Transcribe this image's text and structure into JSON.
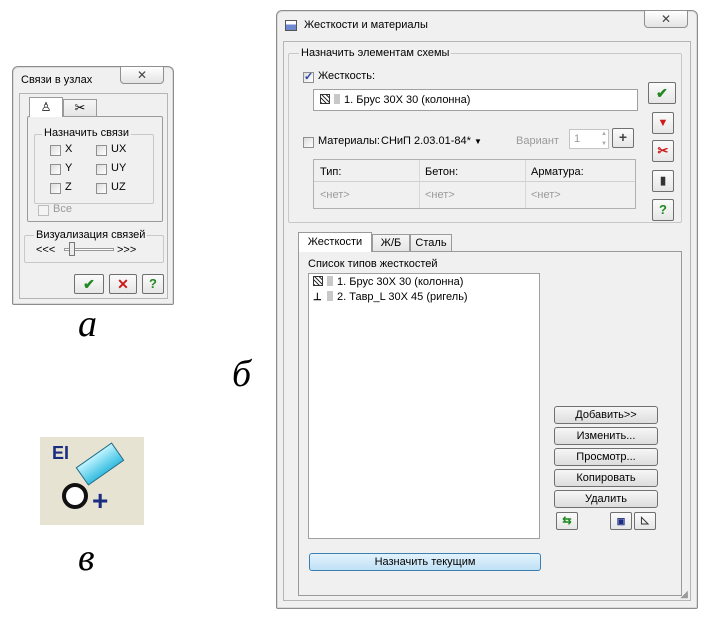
{
  "nodes_dialog": {
    "title": "Связи в узлах",
    "close": "✕",
    "group_title": "Назначить связи",
    "checks": [
      "X",
      "Y",
      "Z",
      "UX",
      "UY",
      "UZ"
    ],
    "all_label": "Все",
    "viz_label": "Визуализация связей",
    "slider_left": "<<<",
    "slider_right": ">>>",
    "ok": "✔",
    "cancel": "✕",
    "help": "?"
  },
  "captions": {
    "a": "а",
    "b": "б",
    "c": "в"
  },
  "stiff_dialog": {
    "title": "Жесткости и материалы",
    "close": "✕",
    "assign_group": "Назначить элементам схемы",
    "stiffness_label": "Жесткость:",
    "stiffness_checked": true,
    "stiffness_value": "1. Брус 30Х 30 (колонна)",
    "materials_label": "Материалы:",
    "materials_checked": false,
    "norm": "СНиП 2.03.01-84*",
    "variant_label": "Вариант",
    "variant_value": "1",
    "mat_headers": [
      "Тип:",
      "Бетон:",
      "Арматура:"
    ],
    "mat_values": [
      "<нет>",
      "<нет>",
      "<нет>"
    ],
    "tabs": [
      "Жесткости",
      "Ж/Б",
      "Сталь"
    ],
    "active_tab": "Жесткости",
    "list_title": "Список типов жесткостей",
    "list_items": [
      "1. Брус 30Х 30 (колонна)",
      "2. Тавр_L 30Х 45 (ригель)"
    ],
    "buttons": [
      "Добавить>>",
      "Изменить...",
      "Просмотр...",
      "Копировать",
      "Удалить"
    ],
    "assign_current": "Назначить текущим",
    "help": "?"
  },
  "logo": {
    "text": "EI"
  },
  "colors": {
    "ok": "#1f8a1f",
    "cancel": "#cc1a1a",
    "accent": "#bfe0f5"
  }
}
